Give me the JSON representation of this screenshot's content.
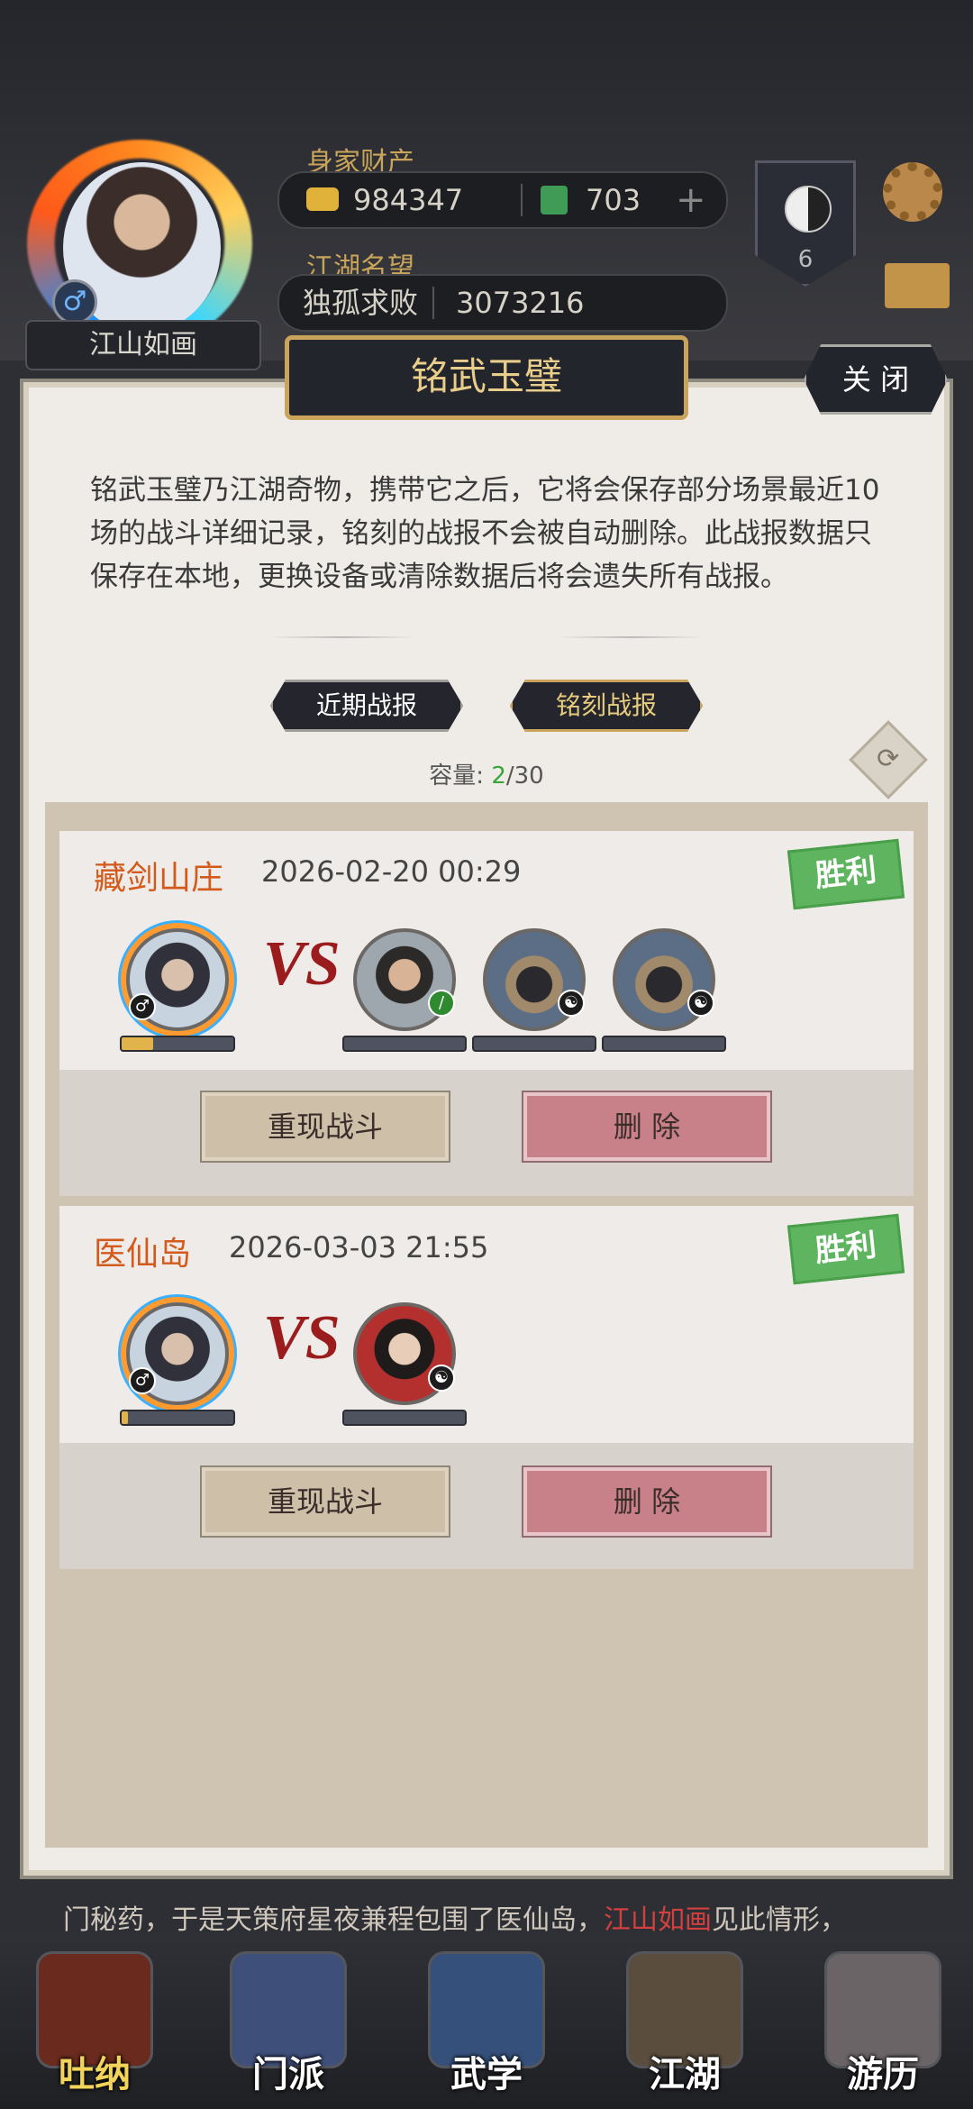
{
  "header": {
    "player_name": "江山如画",
    "gender_symbol": "♂",
    "wealth_label": "身家财产",
    "gold": "984347",
    "jade": "703",
    "plus": "+",
    "fame_label": "江湖名望",
    "title": "独孤求败",
    "fame_value": "3073216",
    "yinyang_level": "6"
  },
  "dialog": {
    "title": "铭武玉璧",
    "close_label": "关 闭",
    "description": "铭武玉璧乃江湖奇物，携带它之后，它将会保存部分场景最近10场的战斗详细记录，铭刻的战报不会被自动删除。此战报数据只保存在本地，更换设备或清除数据后将会遗失所有战报。",
    "tabs": [
      {
        "label": "近期战报"
      },
      {
        "label": "铭刻战报"
      }
    ],
    "capacity_label": "容量:",
    "capacity_used": "2",
    "capacity_total": "/30",
    "records": [
      {
        "location": "藏剑山庄",
        "datetime": "2026-02-20 00:29",
        "result": "胜利",
        "vs": "VS",
        "player_hp": 0.28,
        "replay_label": "重现战斗",
        "delete_label": "删 除"
      },
      {
        "location": "医仙岛",
        "datetime": "2026-03-03 21:55",
        "result": "胜利",
        "vs": "VS",
        "player_hp": 0.06,
        "replay_label": "重现战斗",
        "delete_label": "删 除"
      }
    ]
  },
  "story": {
    "before": "门秘药，于是天策府星夜兼程包围了医仙岛，",
    "highlight": "江山如画",
    "after": "见此情形，"
  },
  "nav": [
    {
      "label": "吐纳"
    },
    {
      "label": "门派"
    },
    {
      "label": "武学"
    },
    {
      "label": "江湖"
    },
    {
      "label": "游历"
    }
  ],
  "colors": {
    "accent_gold": "#c9a45a",
    "location": "#d35a1a",
    "win_green": "#5fb55f",
    "delete_pink": "#c88089"
  }
}
